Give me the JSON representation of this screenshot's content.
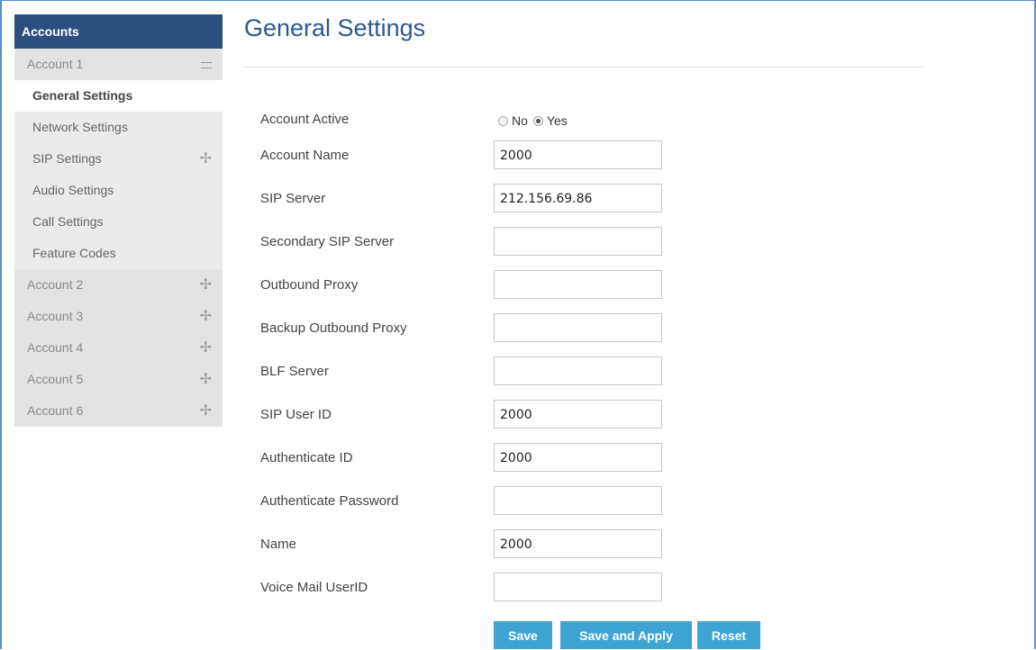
{
  "sidebar": {
    "header": "Accounts",
    "accounts": [
      {
        "label": "Account 1",
        "expanded": true
      },
      {
        "label": "Account 2",
        "expanded": false
      },
      {
        "label": "Account 3",
        "expanded": false
      },
      {
        "label": "Account 4",
        "expanded": false
      },
      {
        "label": "Account 5",
        "expanded": false
      },
      {
        "label": "Account 6",
        "expanded": false
      }
    ],
    "account1_items": [
      {
        "label": "General Settings",
        "active": true
      },
      {
        "label": "Network Settings"
      },
      {
        "label": "SIP Settings",
        "icon": "plus-icon"
      },
      {
        "label": "Audio Settings"
      },
      {
        "label": "Call Settings"
      },
      {
        "label": "Feature Codes"
      }
    ]
  },
  "page": {
    "title": "General Settings"
  },
  "form": {
    "account_active": {
      "label": "Account Active",
      "option_no": "No",
      "option_yes": "Yes",
      "selected": "Yes"
    },
    "fields": [
      {
        "label": "Account Name",
        "value": "2000"
      },
      {
        "label": "SIP Server",
        "value": "212.156.69.86"
      },
      {
        "label": "Secondary SIP Server",
        "value": ""
      },
      {
        "label": "Outbound Proxy",
        "value": ""
      },
      {
        "label": "Backup Outbound Proxy",
        "value": ""
      },
      {
        "label": "BLF Server",
        "value": ""
      },
      {
        "label": "SIP User ID",
        "value": "2000"
      },
      {
        "label": "Authenticate ID",
        "value": "2000"
      },
      {
        "label": "Authenticate Password",
        "value": ""
      },
      {
        "label": "Name",
        "value": "2000"
      },
      {
        "label": "Voice Mail UserID",
        "value": ""
      }
    ]
  },
  "buttons": {
    "save": "Save",
    "save_apply": "Save and Apply",
    "reset": "Reset"
  },
  "colors": {
    "header_bg": "#2d4f80",
    "title": "#2d5a92",
    "button": "#3ea5d3"
  }
}
